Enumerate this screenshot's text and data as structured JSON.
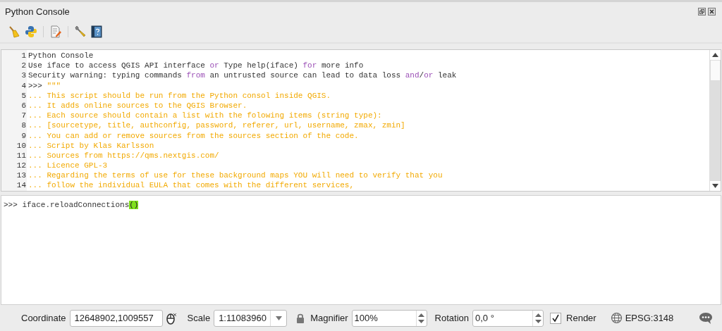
{
  "dock": {
    "title": "Python Console"
  },
  "toolbar": [
    {
      "kind": "broom"
    },
    {
      "kind": "python"
    },
    {
      "kind": "separator"
    },
    {
      "kind": "editor"
    },
    {
      "kind": "separator"
    },
    {
      "kind": "wrench"
    },
    {
      "kind": "help"
    }
  ],
  "output": {
    "lines": [
      {
        "number": "1",
        "segments": [
          {
            "kind": "plain",
            "text": "Python Console"
          }
        ]
      },
      {
        "number": "2",
        "segments": [
          {
            "kind": "plain",
            "text": "Use iface to access QGIS API interface "
          },
          {
            "kind": "keyword",
            "text": "or"
          },
          {
            "kind": "plain",
            "text": " Type help(iface) "
          },
          {
            "kind": "keyword",
            "text": "for"
          },
          {
            "kind": "plain",
            "text": " more info"
          }
        ]
      },
      {
        "number": "3",
        "segments": [
          {
            "kind": "plain",
            "text": "Security warning: typing commands "
          },
          {
            "kind": "keyword",
            "text": "from"
          },
          {
            "kind": "plain",
            "text": " an untrusted source can lead to data loss "
          },
          {
            "kind": "keyword",
            "text": "and"
          },
          {
            "kind": "plain",
            "text": "/"
          },
          {
            "kind": "keyword",
            "text": "or"
          },
          {
            "kind": "plain",
            "text": " leak"
          }
        ]
      },
      {
        "number": "4",
        "segments": [
          {
            "kind": "plain",
            "text": ">>> "
          },
          {
            "kind": "string",
            "text": "\"\"\""
          }
        ]
      },
      {
        "number": "5",
        "segments": [
          {
            "kind": "string",
            "text": "... This script should be run from the Python consol inside QGIS."
          }
        ]
      },
      {
        "number": "6",
        "segments": [
          {
            "kind": "string",
            "text": "... It adds online sources to the QGIS Browser."
          }
        ]
      },
      {
        "number": "7",
        "segments": [
          {
            "kind": "string",
            "text": "... Each source should contain a list with the folowing items (string type):"
          }
        ]
      },
      {
        "number": "8",
        "segments": [
          {
            "kind": "string",
            "text": "... [sourcetype, title, authconfig, password, referer, url, username, zmax, zmin]"
          }
        ]
      },
      {
        "number": "9",
        "segments": [
          {
            "kind": "string",
            "text": "... You can add or remove sources from the sources section of the code."
          }
        ]
      },
      {
        "number": "10",
        "segments": [
          {
            "kind": "string",
            "text": "... Script by Klas Karlsson"
          }
        ]
      },
      {
        "number": "11",
        "segments": [
          {
            "kind": "string",
            "text": "... Sources from https://qms.nextgis.com/"
          }
        ]
      },
      {
        "number": "12",
        "segments": [
          {
            "kind": "string",
            "text": "... Licence GPL-3"
          }
        ]
      },
      {
        "number": "13",
        "segments": [
          {
            "kind": "string",
            "text": "... Regarding the terms of use for these background maps YOU will need to verify that you"
          }
        ]
      },
      {
        "number": "14",
        "segments": [
          {
            "kind": "string",
            "text": "... follow the individual EULA that comes with the different services,"
          }
        ]
      }
    ]
  },
  "input": {
    "segments": [
      {
        "kind": "plain",
        "text": ">>> iface.reloadConnections"
      },
      {
        "kind": "match",
        "text": "()"
      }
    ]
  },
  "status_bar": {
    "coordinate": {
      "label": "Coordinate",
      "value": "12648902,1009557"
    },
    "scale": {
      "label": "Scale",
      "value": "1:11083960"
    },
    "magnifier": {
      "label": "Magnifier",
      "value": "100%"
    },
    "rotation": {
      "label": "Rotation",
      "value": "0,0 °"
    },
    "render": {
      "label": "Render",
      "checked": true
    },
    "crs": {
      "label": "EPSG:3148"
    }
  }
}
